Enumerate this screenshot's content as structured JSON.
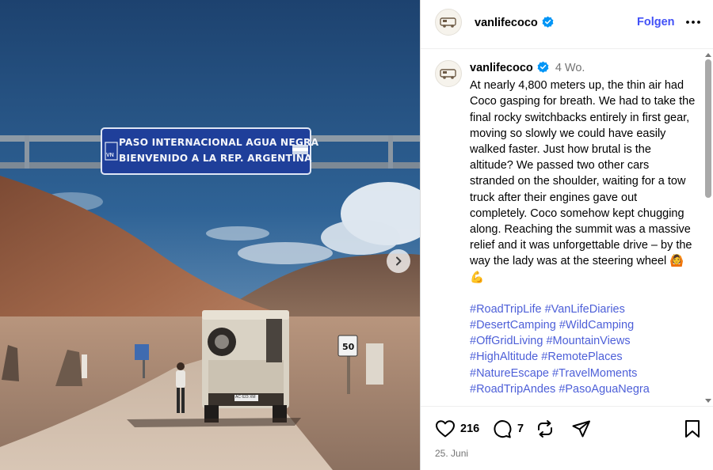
{
  "photo": {
    "sign_line_1": "PASO INTERNACIONAL AGUA NEGRA",
    "sign_line_2": "BIENVENIDO A LA REP. ARGENTINA",
    "sign_badge": "VN",
    "road_sign_number": "50",
    "plate": "AC 623 XM"
  },
  "header": {
    "username": "vanlifecoco",
    "follow_label": "Folgen",
    "more_label": "•••"
  },
  "post": {
    "username": "vanlifecoco",
    "time_ago": "4 Wo.",
    "text": "At nearly 4,800 meters up, the thin air had Coco gasping for breath. We had to take the final rocky switchbacks entirely in first gear, moving so slowly we could have easily walked faster. Just how brutal is the altitude? We passed two other cars stranded on the shoulder, waiting for a tow truck after their engines gave out completely. Coco somehow kept chugging along. Reaching the summit was a massive relief and it was unforgettable drive – by the way the lady was at the steering wheel 🙆 💪",
    "hashtags": [
      "#RoadTripLife",
      "#VanLifeDiaries",
      "#DesertCamping",
      "#WildCamping",
      "#OffGridLiving",
      "#MountainViews",
      "#HighAltitude",
      "#RemotePlaces",
      "#NatureEscape",
      "#TravelMoments",
      "#RoadTripAndes",
      "#PasoAguaNegra"
    ]
  },
  "actions": {
    "likes": "216",
    "comments": "7",
    "date": "25. Juni"
  },
  "colors": {
    "link": "#4150f7",
    "hashtag": "#4d5fd8",
    "muted": "#737373",
    "verified": "#0095f6"
  }
}
